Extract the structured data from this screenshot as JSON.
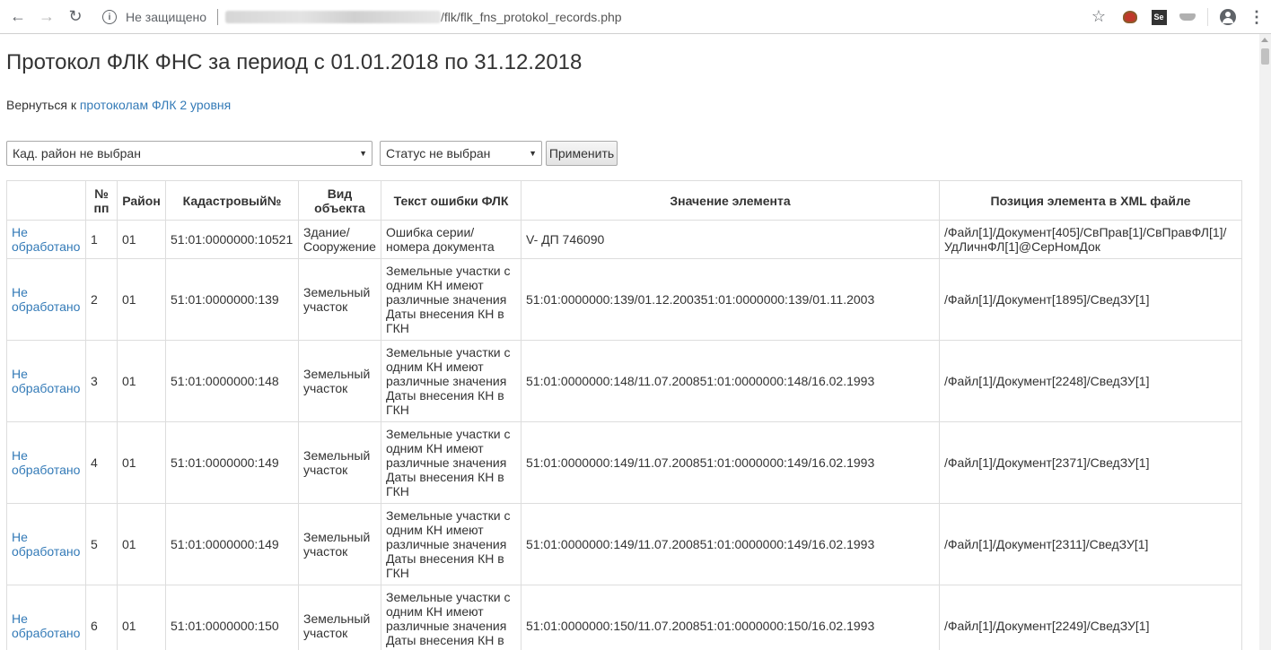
{
  "browser": {
    "security_label": "Не защищено",
    "url_path": "/flk/flk_fns_protokol_records.php",
    "ext_se_label": "Se"
  },
  "page": {
    "title": "Протокол ФЛК ФНС за период с 01.01.2018 по 31.12.2018",
    "back_prefix": "Вернуться к ",
    "back_link": "протоколам ФЛК 2 уровня"
  },
  "filters": {
    "district": "Кад. район не выбран",
    "status": "Статус не выбран",
    "apply": "Применить"
  },
  "table": {
    "headers": [
      "",
      "№ пп",
      "Район",
      "Кадастровый№",
      "Вид объекта",
      "Текст ошибки ФЛК",
      "Значение элемента",
      "Позиция элемента в XML файле"
    ],
    "rows": [
      {
        "status": "Не обработано",
        "num": "1",
        "district": "01",
        "cadastral": "51:01:0000000:10521",
        "object_type": "Здание/ Сооружение",
        "error_text": "Ошибка серии/ номера документа",
        "value": "V- ДП 746090",
        "position": "/Файл[1]/Документ[405]/СвПрав[1]/СвПравФЛ[1]/ УдЛичнФЛ[1]@СерНомДок"
      },
      {
        "status": "Не обработано",
        "num": "2",
        "district": "01",
        "cadastral": "51:01:0000000:139",
        "object_type": "Земельный участок",
        "error_text": "Земельные участки с одним КН имеют различные значения Даты внесения КН в ГКН",
        "value": "51:01:0000000:139/01.12.200351:01:0000000:139/01.11.2003",
        "position": "/Файл[1]/Документ[1895]/СведЗУ[1]"
      },
      {
        "status": "Не обработано",
        "num": "3",
        "district": "01",
        "cadastral": "51:01:0000000:148",
        "object_type": "Земельный участок",
        "error_text": "Земельные участки с одним КН имеют различные значения Даты внесения КН в ГКН",
        "value": "51:01:0000000:148/11.07.200851:01:0000000:148/16.02.1993",
        "position": "/Файл[1]/Документ[2248]/СведЗУ[1]"
      },
      {
        "status": "Не обработано",
        "num": "4",
        "district": "01",
        "cadastral": "51:01:0000000:149",
        "object_type": "Земельный участок",
        "error_text": "Земельные участки с одним КН имеют различные значения Даты внесения КН в ГКН",
        "value": "51:01:0000000:149/11.07.200851:01:0000000:149/16.02.1993",
        "position": "/Файл[1]/Документ[2371]/СведЗУ[1]"
      },
      {
        "status": "Не обработано",
        "num": "5",
        "district": "01",
        "cadastral": "51:01:0000000:149",
        "object_type": "Земельный участок",
        "error_text": "Земельные участки с одним КН имеют различные значения Даты внесения КН в ГКН",
        "value": "51:01:0000000:149/11.07.200851:01:0000000:149/16.02.1993",
        "position": "/Файл[1]/Документ[2311]/СведЗУ[1]"
      },
      {
        "status": "Не обработано",
        "num": "6",
        "district": "01",
        "cadastral": "51:01:0000000:150",
        "object_type": "Земельный участок",
        "error_text": "Земельные участки с одним КН имеют различные значения Даты внесения КН в ГКН",
        "value": "51:01:0000000:150/11.07.200851:01:0000000:150/16.02.1993",
        "position": "/Файл[1]/Документ[2249]/СведЗУ[1]"
      }
    ]
  }
}
